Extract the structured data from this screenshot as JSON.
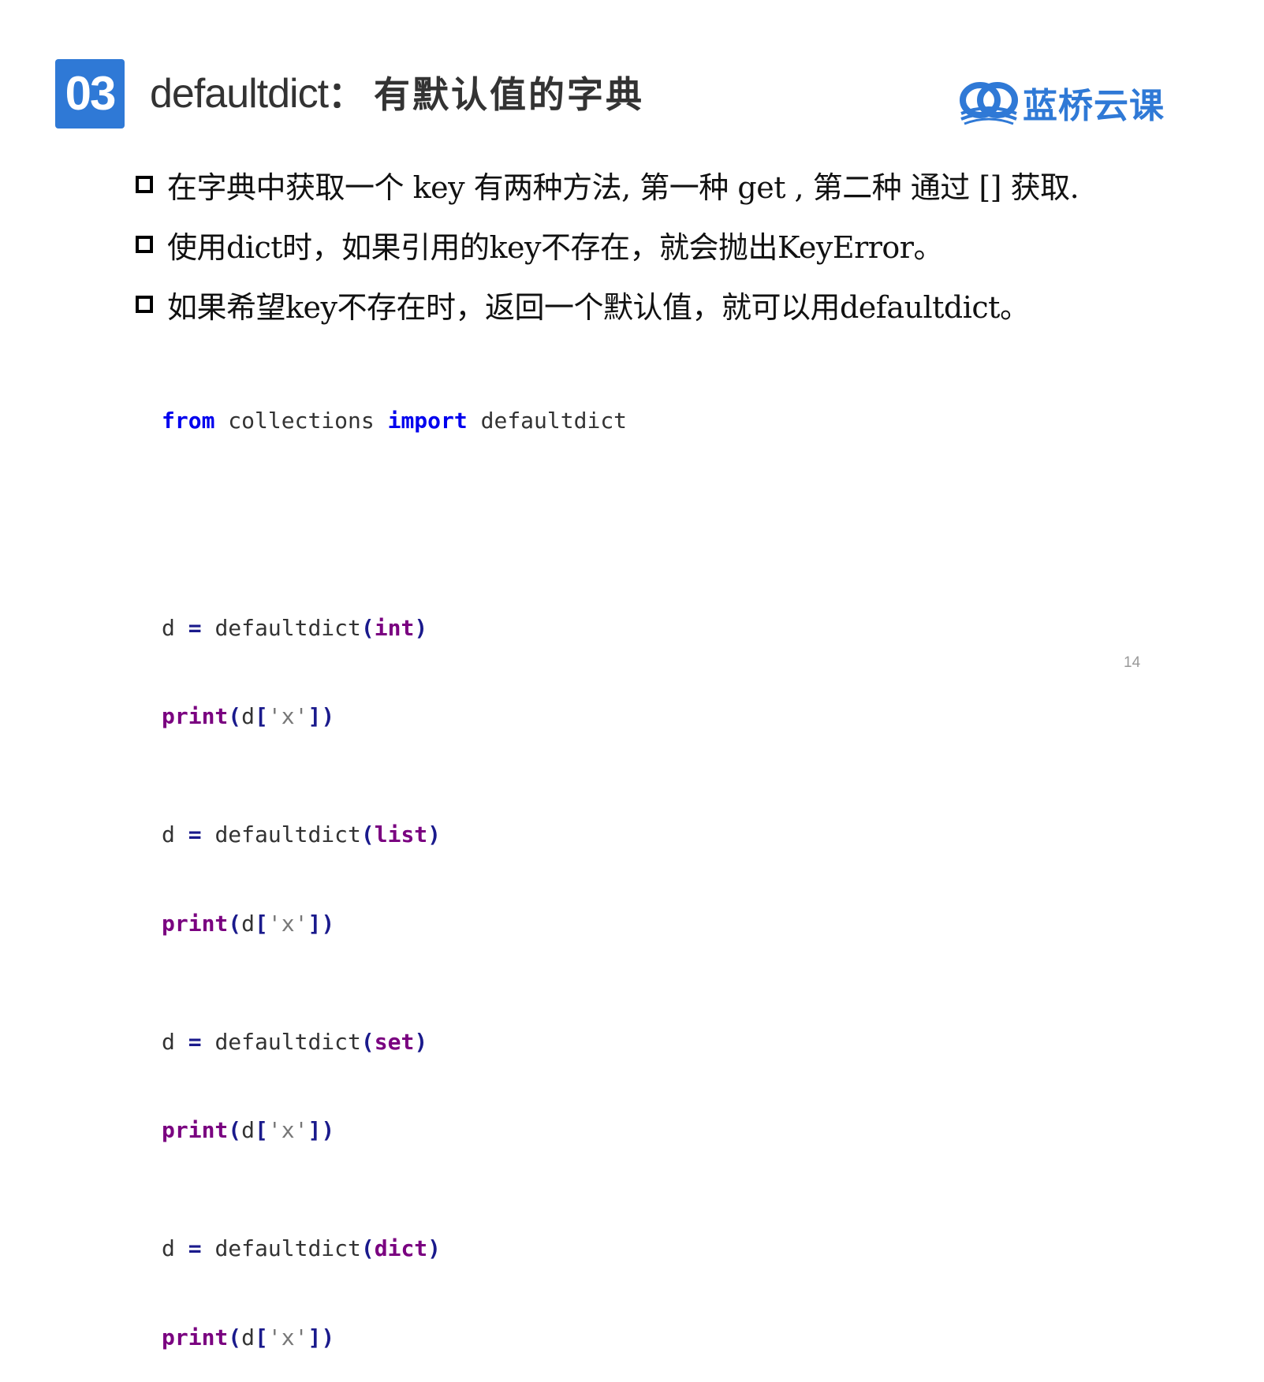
{
  "header": {
    "section_number": "03",
    "title_en": "defaultdict",
    "title_colon": "：",
    "title_cn": "有默认值的字典"
  },
  "logo": {
    "text": "蓝桥云课",
    "icon": "lanqiao-logo-icon",
    "color": "#2f79d6"
  },
  "bullets": [
    {
      "icon": "checkbox-icon",
      "text": "在字典中获取一个 key 有两种方法, 第一种 get , 第二种 通过 [] 获取."
    },
    {
      "icon": "checkbox-icon",
      "text": "使用dict时，如果引用的key不存在，就会抛出KeyError。"
    },
    {
      "icon": "checkbox-icon",
      "text": "如果希望key不存在时，返回一个默认值，就可以用defaultdict。"
    }
  ],
  "code": {
    "import_line": {
      "kw_from": "from",
      "module": "collections",
      "kw_import": "import",
      "name": "defaultdict"
    },
    "lines": [
      {
        "var": "d",
        "op": "=",
        "func": "defaultdict",
        "open": "(",
        "arg": "int",
        "close": ")"
      },
      {
        "kw": "print",
        "open": "(",
        "var": "d",
        "lbr": "[",
        "str": "'x'",
        "rbr": "]",
        "close": ")"
      },
      {
        "var": "d",
        "op": "=",
        "func": "defaultdict",
        "open": "(",
        "arg": "list",
        "close": ")"
      },
      {
        "kw": "print",
        "open": "(",
        "var": "d",
        "lbr": "[",
        "str": "'x'",
        "rbr": "]",
        "close": ")"
      },
      {
        "var": "d",
        "op": "=",
        "func": "defaultdict",
        "open": "(",
        "arg": "set",
        "close": ")"
      },
      {
        "kw": "print",
        "open": "(",
        "var": "d",
        "lbr": "[",
        "str": "'x'",
        "rbr": "]",
        "close": ")"
      },
      {
        "var": "d",
        "op": "=",
        "func": "defaultdict",
        "open": "(",
        "arg": "dict",
        "close": ")"
      },
      {
        "kw": "print",
        "open": "(",
        "var": "d",
        "lbr": "[",
        "str": "'x'",
        "rbr": "]",
        "close": ")"
      }
    ]
  },
  "footer": {
    "page_number": "14"
  },
  "colors": {
    "accent": "#2f79d6",
    "keyword_blue": "#0000ee",
    "keyword_purple": "#7a0080"
  }
}
